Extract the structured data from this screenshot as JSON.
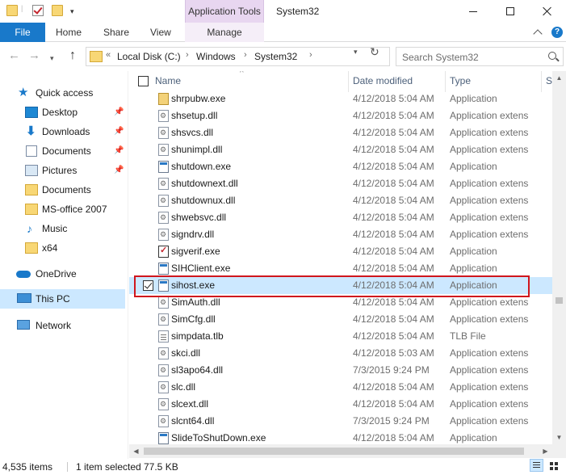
{
  "window": {
    "title": "System32",
    "context_tab_group": "Application Tools"
  },
  "ribbon": {
    "tabs": [
      "File",
      "Home",
      "Share",
      "View",
      "Manage"
    ],
    "help": "?"
  },
  "address": {
    "overflow": "«",
    "segments": [
      "Local Disk (C:)",
      "Windows",
      "System32"
    ],
    "separator": "›"
  },
  "search": {
    "placeholder": "Search System32"
  },
  "nav": {
    "items": [
      {
        "label": "Quick access"
      },
      {
        "label": "Desktop"
      },
      {
        "label": "Downloads"
      },
      {
        "label": "Documents"
      },
      {
        "label": "Pictures"
      },
      {
        "label": "Documents"
      },
      {
        "label": "MS-office 2007"
      },
      {
        "label": "Music"
      },
      {
        "label": "x64"
      },
      {
        "label": "OneDrive"
      },
      {
        "label": "This PC"
      },
      {
        "label": "Network"
      }
    ]
  },
  "columns": {
    "name": "Name",
    "date": "Date modified",
    "type": "Type",
    "size": "Si"
  },
  "files": [
    {
      "name": "shrpubw.exe",
      "date": "4/12/2018 5:04 AM",
      "type": "Application"
    },
    {
      "name": "shsetup.dll",
      "date": "4/12/2018 5:04 AM",
      "type": "Application extens"
    },
    {
      "name": "shsvcs.dll",
      "date": "4/12/2018 5:04 AM",
      "type": "Application extens"
    },
    {
      "name": "shunimpl.dll",
      "date": "4/12/2018 5:04 AM",
      "type": "Application extens"
    },
    {
      "name": "shutdown.exe",
      "date": "4/12/2018 5:04 AM",
      "type": "Application"
    },
    {
      "name": "shutdownext.dll",
      "date": "4/12/2018 5:04 AM",
      "type": "Application extens"
    },
    {
      "name": "shutdownux.dll",
      "date": "4/12/2018 5:04 AM",
      "type": "Application extens"
    },
    {
      "name": "shwebsvc.dll",
      "date": "4/12/2018 5:04 AM",
      "type": "Application extens"
    },
    {
      "name": "signdrv.dll",
      "date": "4/12/2018 5:04 AM",
      "type": "Application extens"
    },
    {
      "name": "sigverif.exe",
      "date": "4/12/2018 5:04 AM",
      "type": "Application"
    },
    {
      "name": "SIHClient.exe",
      "date": "4/12/2018 5:04 AM",
      "type": "Application"
    },
    {
      "name": "sihost.exe",
      "date": "4/12/2018 5:04 AM",
      "type": "Application"
    },
    {
      "name": "SimAuth.dll",
      "date": "4/12/2018 5:04 AM",
      "type": "Application extens"
    },
    {
      "name": "SimCfg.dll",
      "date": "4/12/2018 5:04 AM",
      "type": "Application extens"
    },
    {
      "name": "simpdata.tlb",
      "date": "4/12/2018 5:04 AM",
      "type": "TLB File"
    },
    {
      "name": "skci.dll",
      "date": "4/12/2018 5:03 AM",
      "type": "Application extens"
    },
    {
      "name": "sl3apo64.dll",
      "date": "7/3/2015 9:24 PM",
      "type": "Application extens"
    },
    {
      "name": "slc.dll",
      "date": "4/12/2018 5:04 AM",
      "type": "Application extens"
    },
    {
      "name": "slcext.dll",
      "date": "4/12/2018 5:04 AM",
      "type": "Application extens"
    },
    {
      "name": "slcnt64.dll",
      "date": "7/3/2015 9:24 PM",
      "type": "Application extens"
    },
    {
      "name": "SlideToShutDown.exe",
      "date": "4/12/2018 5:04 AM",
      "type": "Application"
    }
  ],
  "status": {
    "items": "4,535 items",
    "selected": "1 item selected",
    "size": "77.5 KB"
  }
}
